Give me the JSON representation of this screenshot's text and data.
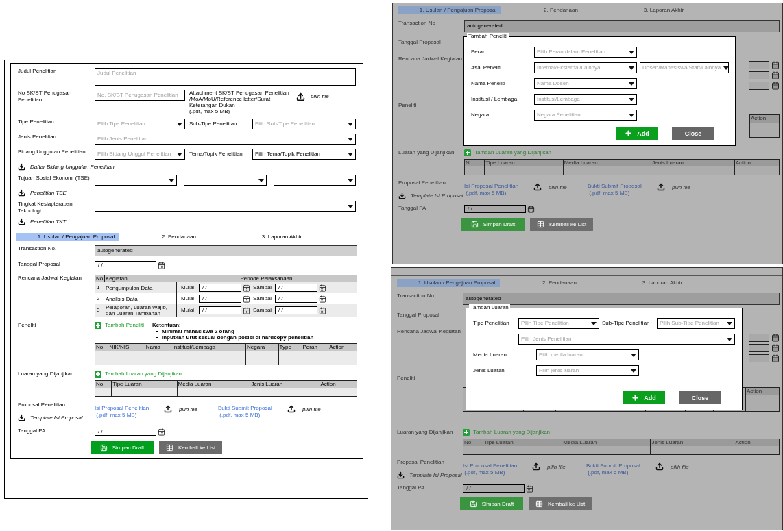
{
  "research_form": {
    "fields": [
      {
        "kind": "textarea",
        "label": "Judul Penelitian",
        "placeholder": "Judul Penelitian"
      },
      {
        "kind": "text",
        "label": "No SK/ST Penugasan Penelitian",
        "placeholder": "No. SK/ST Penugasan Penelitian",
        "attachment": {
          "lines": [
            "Attachment SK/ST Penugasan Penelitian",
            "/MoA/MoU/Reference letter/Surat",
            "Keterangan Dukan",
            "(.pdf, max 5 MB)"
          ],
          "button": "pilih file"
        }
      },
      {
        "kind": "select",
        "label": "Tipe Penelitian",
        "placeholder": "Pilih Tipe Penelitian",
        "right": {
          "label": "Sub-Tipe Penelitian",
          "placeholder": "Pilih Sub-Tipe Penelitian"
        }
      },
      {
        "kind": "wide",
        "label": "Jenis Penelitian",
        "placeholder": "Pilih Jenis Penelitian"
      },
      {
        "kind": "select",
        "label": "Bidang Unggulan Penelitian",
        "placeholder": "Pilih Bidang Unggul Penelitian",
        "right": {
          "label": "Tema/Topik Penelitian",
          "value": "Pilih Tema/Topik Penelitian"
        },
        "download": "Daftar Bidang Unggulan Penelitian"
      },
      {
        "kind": "triple",
        "label": "Tujuan Sosial Ekonomi (TSE)",
        "download": "Penelitian TSE"
      },
      {
        "kind": "wide",
        "label": "Tingkat Kesiapterapan Teknologi",
        "download": "Penelitian TKT"
      }
    ],
    "tabs": [
      {
        "label": "1. Usulan / Pengajuan Proposal",
        "selected": true
      },
      {
        "label": "2. Pendanaan",
        "selected": false
      },
      {
        "label": "3. Laporan Akhir",
        "selected": false
      }
    ],
    "transaction": {
      "label": "Transaction No.",
      "value": "autogenerated"
    },
    "proposal_date": {
      "label": "Tanggal Proposal",
      "value": "/ /"
    },
    "schedule": {
      "label": "Rencana Jadwal Kegiatan",
      "columns": [
        "No",
        "Kegiatan",
        "Periode Pelaksanaan"
      ],
      "rows": [
        {
          "no": "1",
          "activity": "Pengumpulan Data",
          "start_label": "Mulai",
          "start": "/ /",
          "end_label": "Sampai",
          "end": "/ /"
        },
        {
          "no": "2",
          "activity": "Analisis Data",
          "start_label": "Mulai",
          "start": "/ /",
          "end_label": "Sampai",
          "end": "/ /"
        },
        {
          "no": "3",
          "activity": "Pelaporan, Luaran Wajib, dan Luaran Tambahan",
          "start_label": "Mulai",
          "start": "/ /",
          "end_label": "Sampai",
          "end": "/ /"
        }
      ]
    },
    "researchers": {
      "label": "Peneliti",
      "add": "Tambah Peneliti",
      "notes_title": "Ketentuan:",
      "notes": [
        "Minimal mahasiswa 2 orang",
        "Inputkan urut sesuai dengan posisi di hardcopy penelitian"
      ],
      "columns": [
        "No",
        "NIK/NIS",
        "Nama",
        "Institusi/Lembaga",
        "Negara",
        "Type",
        "Peran",
        "Action"
      ]
    },
    "outputs": {
      "label": "Luaran yang Dijanjikan",
      "add": "Tambah Luaran yang Dijanjikan",
      "columns": [
        "No",
        "Tipe Luaran",
        "Media Luaran",
        "Jenis Luaran",
        "Action"
      ]
    },
    "proposal": {
      "label": "Proposal Penelitian",
      "template": "Template Isi Proposal",
      "uploads": [
        {
          "label": "Isi Proposal Penelitian",
          "note": "(.pdf, max 5 MB)",
          "button": "pilih file"
        },
        {
          "label": "Bukti Submit Proposal",
          "note": "(.pdf, max 5 MB)",
          "button": "pilih file"
        }
      ]
    },
    "pa_date": {
      "label": "Tanggal PA",
      "value": "/ /"
    },
    "buttons": [
      {
        "label": "Simpan Draft",
        "kind": "save"
      },
      {
        "label": "Kembali ke List",
        "kind": "list"
      }
    ]
  },
  "researcher_dialog_screen": {
    "tabs": [
      {
        "label": "1. Usulan / Pengajuan Proposal",
        "selected": true
      },
      {
        "label": "2. Pendanaan",
        "selected": false
      },
      {
        "label": "3. Laporan Akhir",
        "selected": false
      }
    ],
    "transaction": {
      "label": "Transaction No",
      "value": "autogenerated"
    },
    "proposal_date_label": "Tanggal Proposal",
    "schedule_label": "Rencana Jadwal Kegiatan",
    "researchers_label": "Peneliti",
    "researchers_last_column": "Action",
    "outputs": {
      "label": "Luaran yang Dijanjikan",
      "add": "Tambah Luaran yang Dijanjikan",
      "columns": [
        "No",
        "Tipe Luaran",
        "Media Luaran",
        "Jenis Luaran",
        "Action"
      ]
    },
    "proposal": {
      "label": "Proposal Penelitian",
      "template": "Template Isi Proposal",
      "uploads": [
        {
          "label": "Isi Proposal Penelitian",
          "note": "(.pdf, max 5 MB)",
          "button": "pilih file"
        },
        {
          "label": "Bukti Submit Proposal",
          "note": "(.pdf, max 5 MB)",
          "button": "pilih file"
        }
      ]
    },
    "pa_date": {
      "label": "Tanggal PA",
      "value": "/ /"
    },
    "buttons": [
      {
        "label": "Simpan Draft",
        "kind": "save"
      },
      {
        "label": "Kembali ke List",
        "kind": "list"
      }
    ],
    "dialog": {
      "title": "Tambah Peneliti",
      "fields": [
        {
          "kind": "single",
          "label": "Peran",
          "placeholder": "Pilih Peran dalam Penelitian"
        },
        {
          "kind": "double",
          "label": "Asal Peneliti",
          "placeholder": "Internal/Eksternal/Lainnya",
          "second_placeholder": "Dosen/Mahasiswa/Staff/Lainnya"
        },
        {
          "kind": "single",
          "label": "Nama Peneliti",
          "placeholder": "Nama Dosen"
        },
        {
          "kind": "single",
          "label": "Institusi / Lembaga",
          "placeholder": "Institusi/Lembaga"
        },
        {
          "kind": "single",
          "label": "Negara",
          "placeholder": "Negara Penelitian"
        }
      ],
      "buttons": [
        {
          "label": "Add",
          "kind": "add"
        },
        {
          "label": "Close",
          "kind": "close"
        }
      ]
    }
  },
  "output_dialog_screen": {
    "tabs": [
      {
        "label": "1. Usulan / Pengajuan Proposal",
        "selected": true
      },
      {
        "label": "2. Pendanaan",
        "selected": false
      },
      {
        "label": "3. Laporan Akhir",
        "selected": false
      }
    ],
    "transaction": {
      "label": "Transaction No.",
      "value": "autogenerated"
    },
    "proposal_date_label": "Tanggal Proposal",
    "schedule_label": "Rencana Jadwal Kegiatan",
    "researchers_label": "Peneliti",
    "researchers_last_column": "Action",
    "outputs": {
      "label": "Luaran yang Dijanjikan",
      "add": "Tambah Luaran yang Dijanjikan",
      "columns": [
        "No",
        "Tipe Luaran",
        "Media Luaran",
        "Jenis Luaran",
        "Action"
      ]
    },
    "proposal": {
      "label": "Proposal Penelitian",
      "template": "Template Isi Proposal",
      "uploads": [
        {
          "label": "Isi Proposal Penelitian",
          "note": "(.pdf, max 5 MB)",
          "button": "pilih file"
        },
        {
          "label": "Bukti Submit Proposal",
          "note": "(.pdf, max 5 MB)",
          "button": "pilih file"
        }
      ]
    },
    "pa_date": {
      "label": "Tanggal PA",
      "value": "/ /"
    },
    "buttons": [
      {
        "label": "Simpan Draft",
        "kind": "save"
      },
      {
        "label": "Kembali ke List",
        "kind": "list"
      }
    ],
    "dialog": {
      "title": "Tambah Luaran",
      "fields": [
        {
          "kind": "pair",
          "label": "Tipe Penelitian",
          "placeholder": "Pilih Tipe Penelitian",
          "second_label": "Sub-Tipe Penelitian",
          "second_placeholder": "Pilih Sub-Tipe Penelitian"
        },
        {
          "kind": "wide",
          "placeholder": "Pilih Jenis Penelitian"
        },
        {
          "kind": "single",
          "label": "Media Luaran",
          "placeholder": "Pilih media luaran"
        },
        {
          "kind": "single",
          "label": "Jenis Luaran",
          "placeholder": "Pilih jenis luaran"
        }
      ],
      "buttons": [
        {
          "label": "Add",
          "kind": "add"
        },
        {
          "label": "Close",
          "kind": "close"
        }
      ]
    }
  }
}
